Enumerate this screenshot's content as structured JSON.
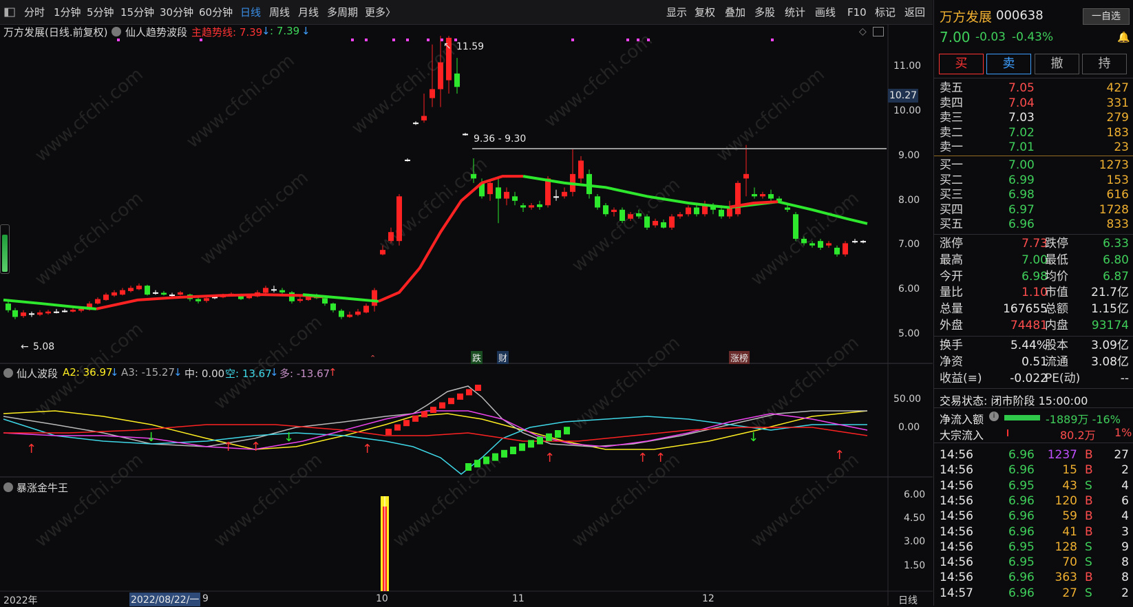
{
  "toolbar": {
    "periods": [
      "分时",
      "1分钟",
      "5分钟",
      "15分钟",
      "30分钟",
      "60分钟",
      "日线",
      "周线",
      "月线",
      "多周期",
      "更多〉"
    ],
    "active": "日线",
    "actions": [
      "显示",
      "复权",
      "叠加",
      "多股",
      "统计",
      "画线",
      "F10",
      "标记",
      "返回"
    ]
  },
  "main_chart": {
    "title": "万方发展(日线.前复权)",
    "indicator": "仙人趋势波段",
    "trend_label": "主趋势线: 7.39",
    "trend_label2": ": 7.39",
    "high_marker": "11.59",
    "low_marker": "5.08",
    "range_label": "9.36 - 9.30",
    "price_box": "10.27",
    "events": [
      "跌",
      "财",
      "涨榜"
    ],
    "y_ticks": [
      "11.00",
      "10.00",
      "9.00",
      "8.00",
      "7.00",
      "6.00",
      "5.00"
    ]
  },
  "sub1": {
    "title": "仙人波段",
    "a2": "A2: 36.97",
    "a3": "A3: -15.27",
    "mid": "中: 0.00",
    "kong": "空: 13.67",
    "duo": "多: -13.67",
    "y_ticks": [
      "50.00",
      "0.00"
    ]
  },
  "sub2": {
    "title": "暴涨金牛王",
    "y_ticks": [
      "6.00",
      "4.50",
      "3.00",
      "1.50"
    ]
  },
  "x_axis": {
    "labels": [
      "2022年",
      "2022/08/22/一",
      "9",
      "10",
      "11",
      "12",
      "日线"
    ]
  },
  "chart_data": {
    "type": "candlestick",
    "title": "万方发展(日线.前复权)",
    "ylim": [
      4.8,
      11.8
    ],
    "high": 11.59,
    "low": 5.08,
    "last": 7.0,
    "trend_line_value": 7.39
  },
  "panel": {
    "name": "万方发展",
    "code": "000638",
    "watch_btn": "一自选",
    "price": "7.00",
    "change": "-0.03",
    "pct": "-0.43%",
    "buttons": [
      "买",
      "卖",
      "撤",
      "持"
    ],
    "asks": [
      {
        "label": "卖五",
        "price": "7.05",
        "vol": "427"
      },
      {
        "label": "卖四",
        "price": "7.04",
        "vol": "331"
      },
      {
        "label": "卖三",
        "price": "7.03",
        "vol": "279"
      },
      {
        "label": "卖二",
        "price": "7.02",
        "vol": "183"
      },
      {
        "label": "卖一",
        "price": "7.01",
        "vol": "23"
      }
    ],
    "bids": [
      {
        "label": "买一",
        "price": "7.00",
        "vol": "1273"
      },
      {
        "label": "买二",
        "price": "6.99",
        "vol": "153"
      },
      {
        "label": "买三",
        "price": "6.98",
        "vol": "616"
      },
      {
        "label": "买四",
        "price": "6.97",
        "vol": "1728"
      },
      {
        "label": "买五",
        "price": "6.96",
        "vol": "833"
      }
    ],
    "stats": [
      [
        "涨停",
        "7.73",
        "跌停",
        "6.33"
      ],
      [
        "最高",
        "7.00",
        "最低",
        "6.80"
      ],
      [
        "今开",
        "6.98",
        "均价",
        "6.87"
      ],
      [
        "量比",
        "1.10",
        "市值",
        "21.7亿"
      ],
      [
        "总量",
        "167655",
        "总额",
        "1.15亿"
      ],
      [
        "外盘",
        "74481",
        "内盘",
        "93174"
      ]
    ],
    "stats2": [
      [
        "换手",
        "5.44%",
        "股本",
        "3.09亿"
      ],
      [
        "净资",
        "0.51",
        "流通",
        "3.08亿"
      ],
      [
        "收益(≡)",
        "-0.022",
        "PE(动)",
        "--"
      ]
    ],
    "trade_status": "交易状态: 闭市阶段 15:00:00",
    "net_inflow_label": "净流入额",
    "net_inflow_value": "-1889万 -16%",
    "block_label": "大宗流入",
    "block_value": "80.2万",
    "block_pct": "1%",
    "ticks": [
      {
        "t": "14:56",
        "p": "6.96",
        "v": "1237",
        "s": "B",
        "n": "27"
      },
      {
        "t": "14:56",
        "p": "6.96",
        "v": "15",
        "s": "B",
        "n": "2"
      },
      {
        "t": "14:56",
        "p": "6.95",
        "v": "43",
        "s": "S",
        "n": "4"
      },
      {
        "t": "14:56",
        "p": "6.96",
        "v": "120",
        "s": "B",
        "n": "6"
      },
      {
        "t": "14:56",
        "p": "6.96",
        "v": "59",
        "s": "B",
        "n": "4"
      },
      {
        "t": "14:56",
        "p": "6.96",
        "v": "41",
        "s": "B",
        "n": "3"
      },
      {
        "t": "14:56",
        "p": "6.95",
        "v": "128",
        "s": "S",
        "n": "9"
      },
      {
        "t": "14:56",
        "p": "6.95",
        "v": "70",
        "s": "S",
        "n": "8"
      },
      {
        "t": "14:56",
        "p": "6.96",
        "v": "363",
        "s": "B",
        "n": "8"
      },
      {
        "t": "14:57",
        "p": "6.96",
        "v": "27",
        "s": "S",
        "n": "2"
      }
    ]
  },
  "watermark": "www.cfchi.com"
}
